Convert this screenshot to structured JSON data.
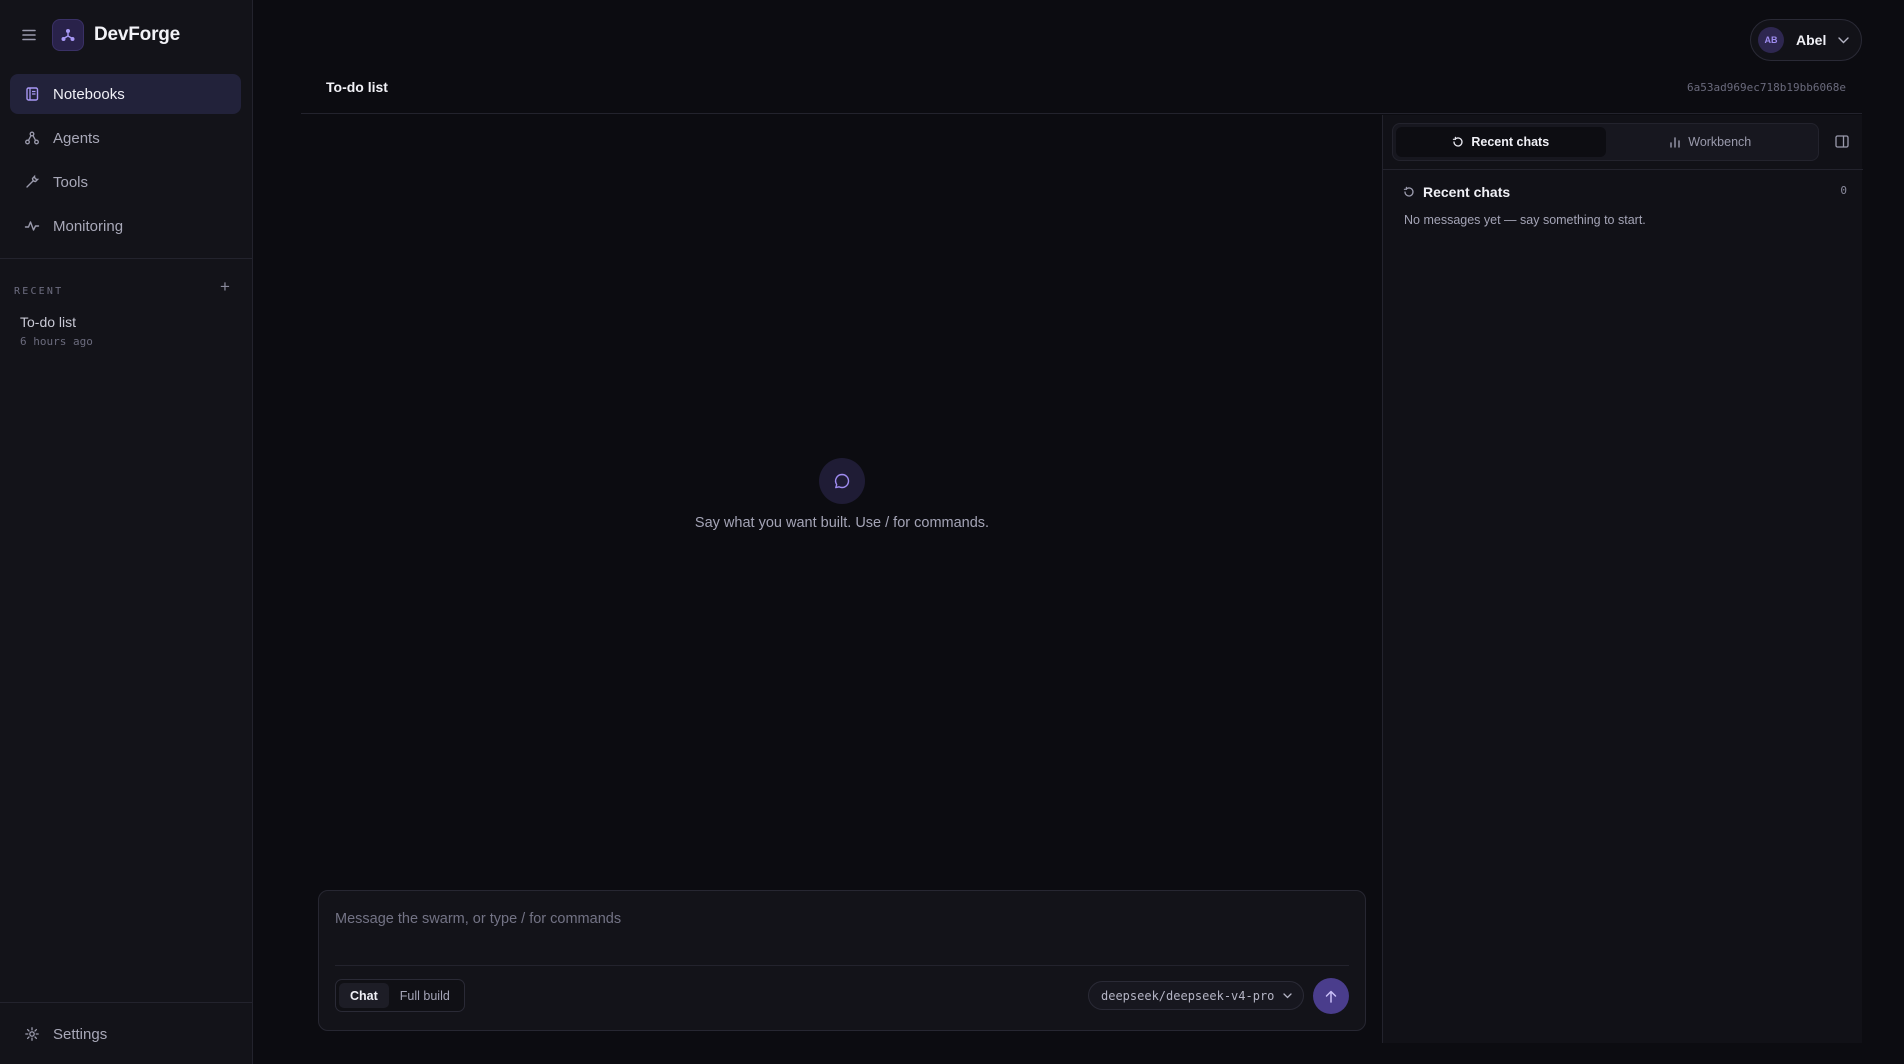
{
  "app": {
    "name": "DevForge"
  },
  "nav": {
    "items": [
      {
        "label": "Notebooks",
        "icon": "notebook-icon",
        "active": true
      },
      {
        "label": "Agents",
        "icon": "agents-icon",
        "active": false
      },
      {
        "label": "Tools",
        "icon": "wrench-icon",
        "active": false
      },
      {
        "label": "Monitoring",
        "icon": "pulse-icon",
        "active": false
      }
    ],
    "settings_label": "Settings"
  },
  "recent": {
    "label": "RECENT",
    "add_symbol": "+",
    "items": [
      {
        "title": "To-do list",
        "time": "6 hours ago"
      }
    ]
  },
  "user": {
    "initials": "AB",
    "name": "Abel"
  },
  "document": {
    "title": "To-do list",
    "id": "6a53ad969ec718b19bb6068e"
  },
  "chat": {
    "empty_message": "Say what you want built. Use / for commands.",
    "input_placeholder": "Message the swarm, or type / for commands",
    "input_value": "",
    "modes": [
      {
        "label": "Chat",
        "active": true
      },
      {
        "label": "Full build",
        "active": false
      }
    ],
    "model": "deepseek/deepseek-v4-pro"
  },
  "panel": {
    "tabs": [
      {
        "label": "Recent chats",
        "icon": "history-icon",
        "active": true
      },
      {
        "label": "Workbench",
        "icon": "bar-chart-icon",
        "active": false
      }
    ],
    "recent_chats": {
      "title": "Recent chats",
      "count": "0",
      "empty": "No messages yet — say something to start."
    }
  },
  "colors": {
    "background": "#0c0c11",
    "sidebar": "#131319",
    "accent": "#4a3d8c",
    "accent_light": "#9f8cf0",
    "active_nav": "#22223a"
  }
}
